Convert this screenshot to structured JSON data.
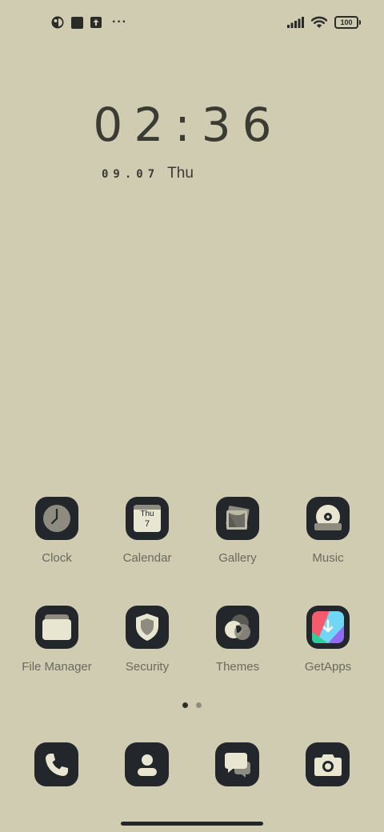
{
  "status_bar": {
    "left_icons": [
      "app-notification-icon",
      "square-notification-icon",
      "upload-notification-icon"
    ],
    "more": "···",
    "right_icons": [
      "signal-icon",
      "wifi-icon"
    ],
    "battery": "100"
  },
  "clock_widget": {
    "time": "02:36",
    "date": "09.07",
    "day": "Thu"
  },
  "apps": [
    {
      "label": "Clock",
      "icon": "clock-icon"
    },
    {
      "label": "Calendar",
      "icon": "calendar-icon",
      "cal_day": "Thu",
      "cal_date": "7"
    },
    {
      "label": "Gallery",
      "icon": "gallery-icon"
    },
    {
      "label": "Music",
      "icon": "music-icon"
    },
    {
      "label": "File Manager",
      "icon": "folder-icon"
    },
    {
      "label": "Security",
      "icon": "shield-icon"
    },
    {
      "label": "Themes",
      "icon": "themes-icon"
    },
    {
      "label": "GetApps",
      "icon": "getapps-icon"
    }
  ],
  "pager": {
    "pages": 2,
    "current": 1
  },
  "dock": [
    {
      "icon": "phone-icon"
    },
    {
      "icon": "contacts-icon"
    },
    {
      "icon": "messages-icon"
    },
    {
      "icon": "camera-icon"
    }
  ],
  "colors": {
    "wallpaper": "#cfccb2",
    "icon_bg": "#23262b",
    "label": "#6a6a5d",
    "getapps_red": "#f45b6c",
    "getapps_green": "#2ccf9a",
    "getapps_purple": "#8f6cf0"
  }
}
